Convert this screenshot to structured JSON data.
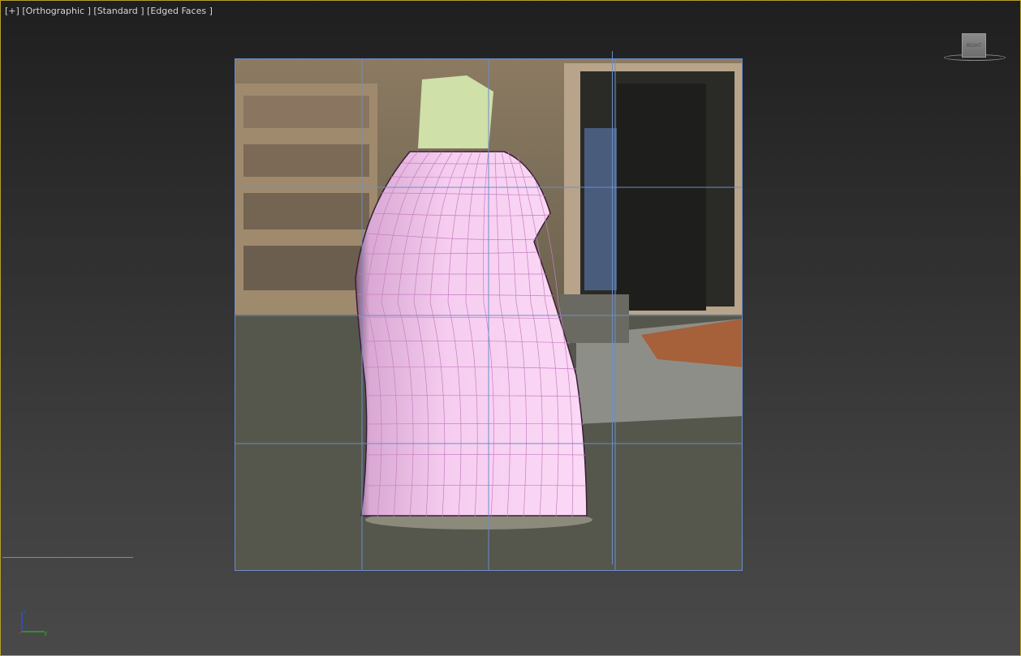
{
  "viewport": {
    "label_plus": "[+]",
    "label_view": "[Orthographic ]",
    "label_shading": "[Standard ]",
    "label_display": "[Edged Faces ]",
    "viewcube_face": "RIGHT"
  },
  "colors": {
    "viewport_border": "#b79c2e",
    "grid_line": "#6c8ec8",
    "mesh_fill": "#f2c6ec",
    "mesh_edge": "#c77fc0",
    "axis_x": "#2fa12f",
    "axis_z": "#2f4fd0"
  },
  "axis_tripod": {
    "z_label": "z",
    "y_label": "y"
  },
  "icons": [
    "viewcube-icon",
    "axis-tripod-icon"
  ]
}
